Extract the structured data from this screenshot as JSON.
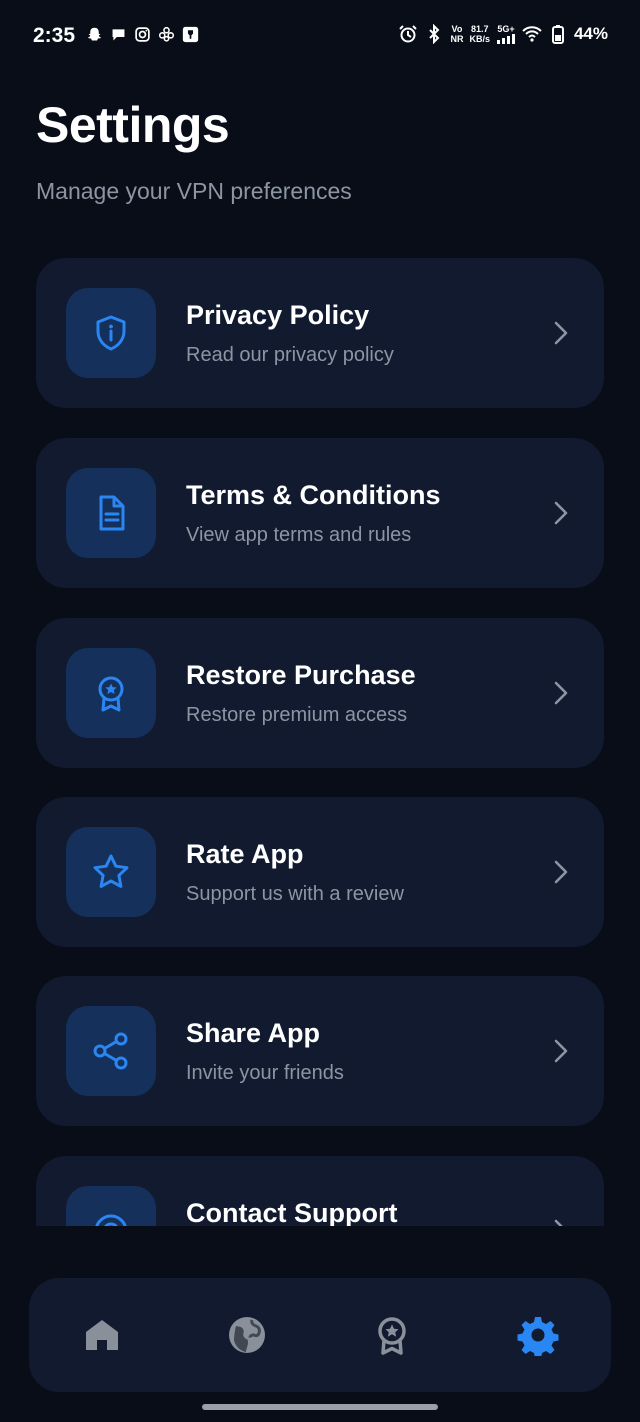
{
  "status_bar": {
    "time": "2:35",
    "left_icons": [
      "snapchat-icon",
      "chat-bubble-icon",
      "instagram-icon",
      "flower-app-icon",
      "app-notification-icon"
    ],
    "network_top": "Vo",
    "network_bottom": "NR",
    "speed_top": "81.7",
    "speed_bottom": "KB/s",
    "signal_label": "5G+",
    "battery": "44%"
  },
  "header": {
    "title": "Settings",
    "subtitle": "Manage your VPN preferences"
  },
  "settings": {
    "items": [
      {
        "icon": "shield-info-icon",
        "title": "Privacy Policy",
        "subtitle": "Read our privacy policy"
      },
      {
        "icon": "document-icon",
        "title": "Terms & Conditions",
        "subtitle": "View app terms and rules"
      },
      {
        "icon": "award-badge-icon",
        "title": "Restore Purchase",
        "subtitle": "Restore premium access"
      },
      {
        "icon": "star-icon",
        "title": "Rate App",
        "subtitle": "Support us with a review"
      },
      {
        "icon": "share-icon",
        "title": "Share App",
        "subtitle": "Invite your friends"
      },
      {
        "icon": "support-icon",
        "title": "Contact Support",
        "subtitle": ""
      }
    ]
  },
  "bottom_nav": {
    "items": [
      {
        "icon": "home-icon",
        "active": false
      },
      {
        "icon": "globe-icon",
        "active": false
      },
      {
        "icon": "award-icon",
        "active": false
      },
      {
        "icon": "gear-icon",
        "active": true
      }
    ]
  },
  "colors": {
    "background": "#080d18",
    "card": "#111a2e",
    "icon_tile": "#15305a",
    "accent": "#2a86f2",
    "muted_text": "#8d95a3",
    "inactive_nav": "#8a909a"
  }
}
